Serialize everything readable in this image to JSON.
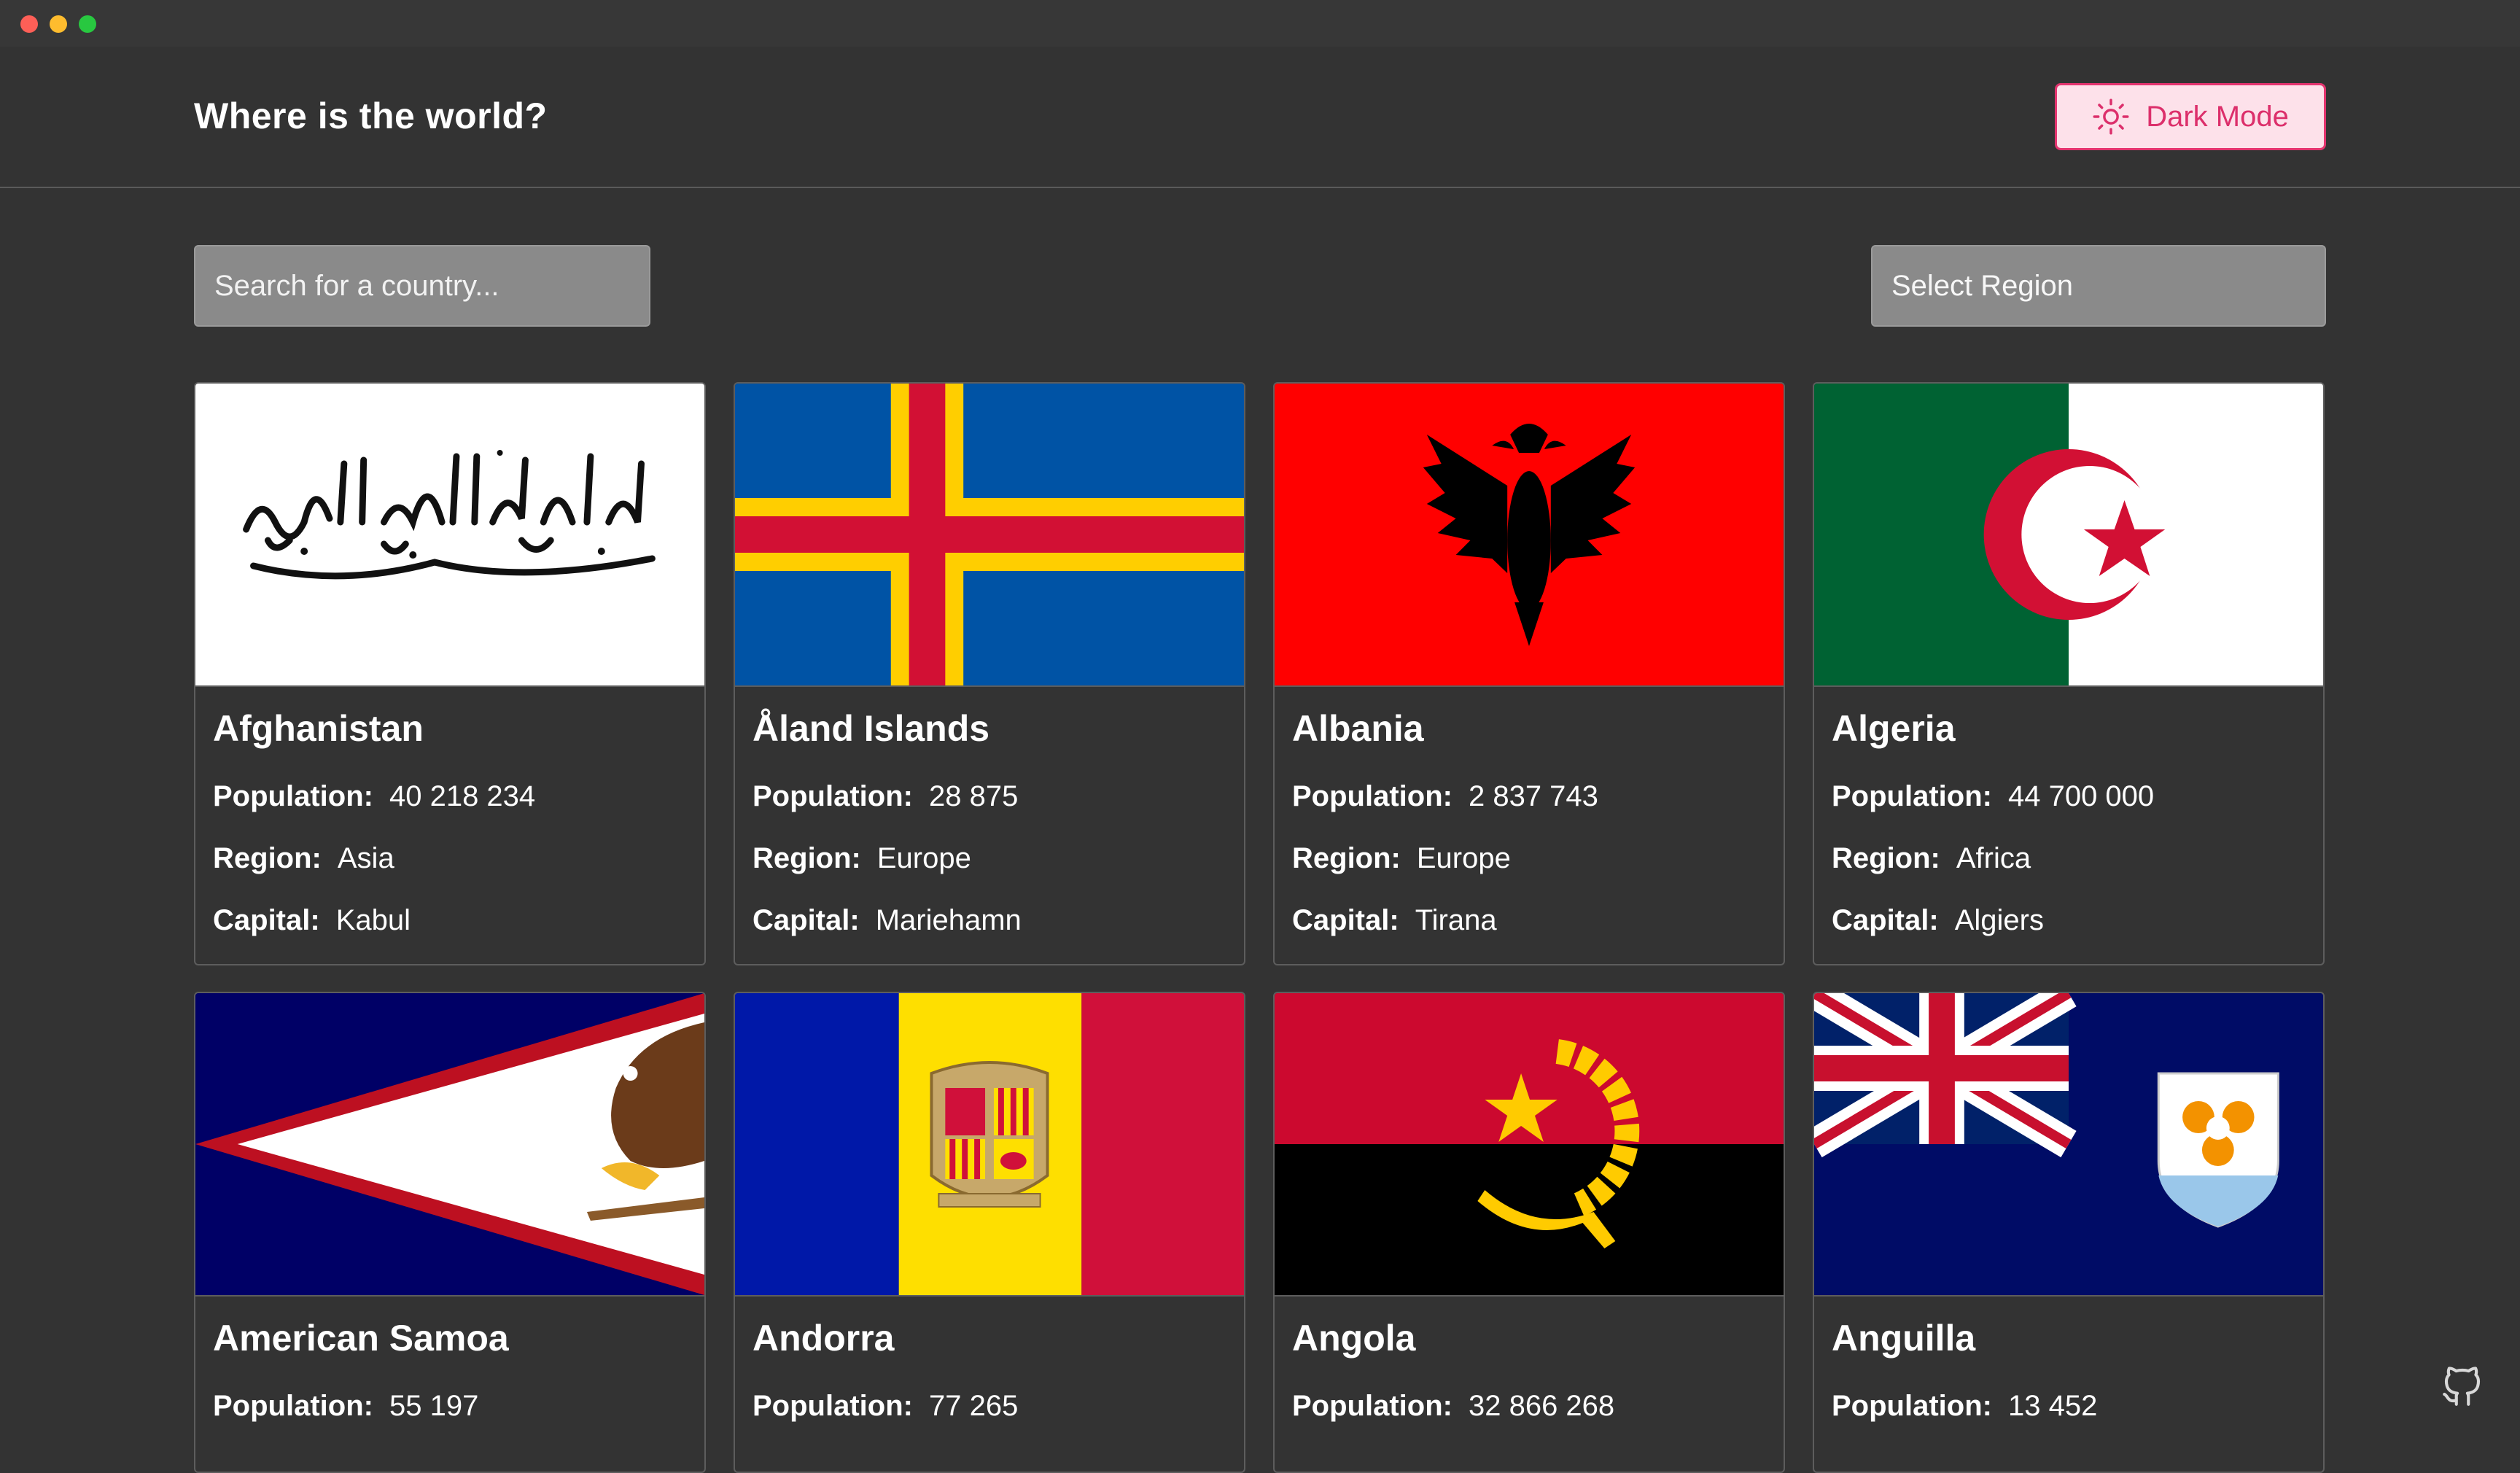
{
  "app": {
    "title": "Where is the world?"
  },
  "header": {
    "theme_button": "Dark Mode",
    "theme_icon": "sun-icon"
  },
  "filters": {
    "search_placeholder": "Search for a country...",
    "region_label": "Select Region"
  },
  "labels": {
    "population": "Population:",
    "region": "Region:",
    "capital": "Capital:"
  },
  "countries": [
    {
      "name": "Afghanistan",
      "population": "40 218 234",
      "region": "Asia",
      "capital": "Kabul"
    },
    {
      "name": "Åland Islands",
      "population": "28 875",
      "region": "Europe",
      "capital": "Mariehamn"
    },
    {
      "name": "Albania",
      "population": "2 837 743",
      "region": "Europe",
      "capital": "Tirana"
    },
    {
      "name": "Algeria",
      "population": "44 700 000",
      "region": "Africa",
      "capital": "Algiers"
    },
    {
      "name": "American Samoa",
      "population": "55 197"
    },
    {
      "name": "Andorra",
      "population": "77 265"
    },
    {
      "name": "Angola",
      "population": "32 866 268"
    },
    {
      "name": "Anguilla",
      "population": "13 452"
    }
  ],
  "colors": {
    "accent": "#e4346f",
    "accent_bg": "#fde1ea",
    "background": "#333333"
  },
  "footer": {
    "icon": "github-icon"
  }
}
